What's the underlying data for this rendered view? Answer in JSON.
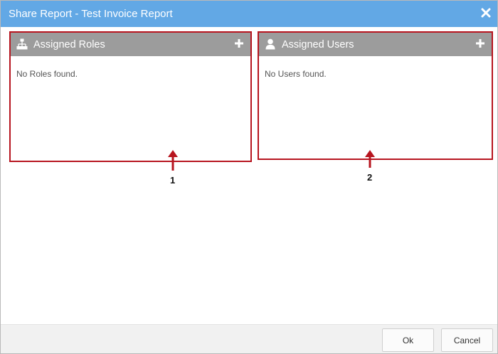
{
  "dialog": {
    "title": "Share Report - Test Invoice Report",
    "close_icon": "close-icon"
  },
  "roles_panel": {
    "title": "Assigned Roles",
    "icon": "hierarchy-icon",
    "add_icon": "plus-icon",
    "empty_text": "No Roles found."
  },
  "users_panel": {
    "title": "Assigned Users",
    "icon": "user-icon",
    "add_icon": "plus-icon",
    "empty_text": "No Users found."
  },
  "annotations": {
    "marker_1": "1",
    "marker_2": "2",
    "highlight_color": "#b7151f"
  },
  "footer": {
    "ok_label": "Ok",
    "cancel_label": "Cancel"
  },
  "colors": {
    "titlebar": "#62a8e5",
    "panel_header": "#9c9c9c",
    "footer": "#f1f1f1"
  }
}
